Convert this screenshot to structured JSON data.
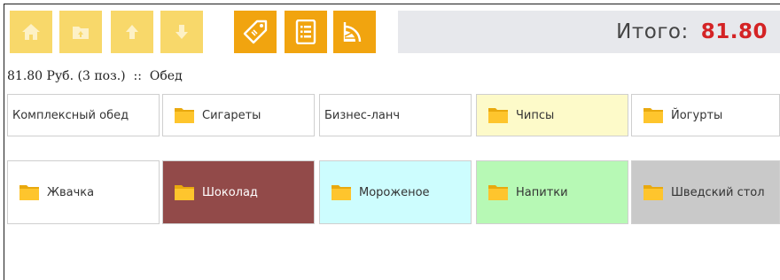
{
  "toolbar": {
    "nav_buttons": [
      {
        "icon": "home-icon"
      },
      {
        "icon": "folder-up-icon"
      },
      {
        "icon": "arrow-up-icon"
      },
      {
        "icon": "arrow-down-icon"
      }
    ],
    "action_buttons": [
      {
        "icon": "price-tag-icon"
      },
      {
        "icon": "list-icon"
      },
      {
        "icon": "citrus-slice-icon"
      }
    ],
    "colors": {
      "nav": "#f8d86a",
      "action": "#f1a40f"
    }
  },
  "total": {
    "label": "Итого:",
    "value": "81.80",
    "value_color": "#d42325"
  },
  "status_line": "81.80 Руб. (3 поз.)  ::  Обед",
  "tiles": [
    {
      "label": "Комплексный обед",
      "folder": false,
      "bg": "#ffffff"
    },
    {
      "label": "Сигареты",
      "folder": true,
      "bg": "#ffffff"
    },
    {
      "label": "Бизнес-ланч",
      "folder": false,
      "bg": "#ffffff"
    },
    {
      "label": "Чипсы",
      "folder": true,
      "bg": "#fdfac9"
    },
    {
      "label": "Йогурты",
      "folder": true,
      "bg": "#ffffff"
    },
    {
      "label": "Жвачка",
      "folder": true,
      "bg": "#ffffff"
    },
    {
      "label": "Шоколад",
      "folder": true,
      "bg": "#924a49"
    },
    {
      "label": "Мороженое",
      "folder": true,
      "bg": "#cdfdfe"
    },
    {
      "label": "Напитки",
      "folder": true,
      "bg": "#b7f9b5"
    },
    {
      "label": "Шведский стол",
      "folder": true,
      "bg": "#c9c9c9"
    }
  ]
}
